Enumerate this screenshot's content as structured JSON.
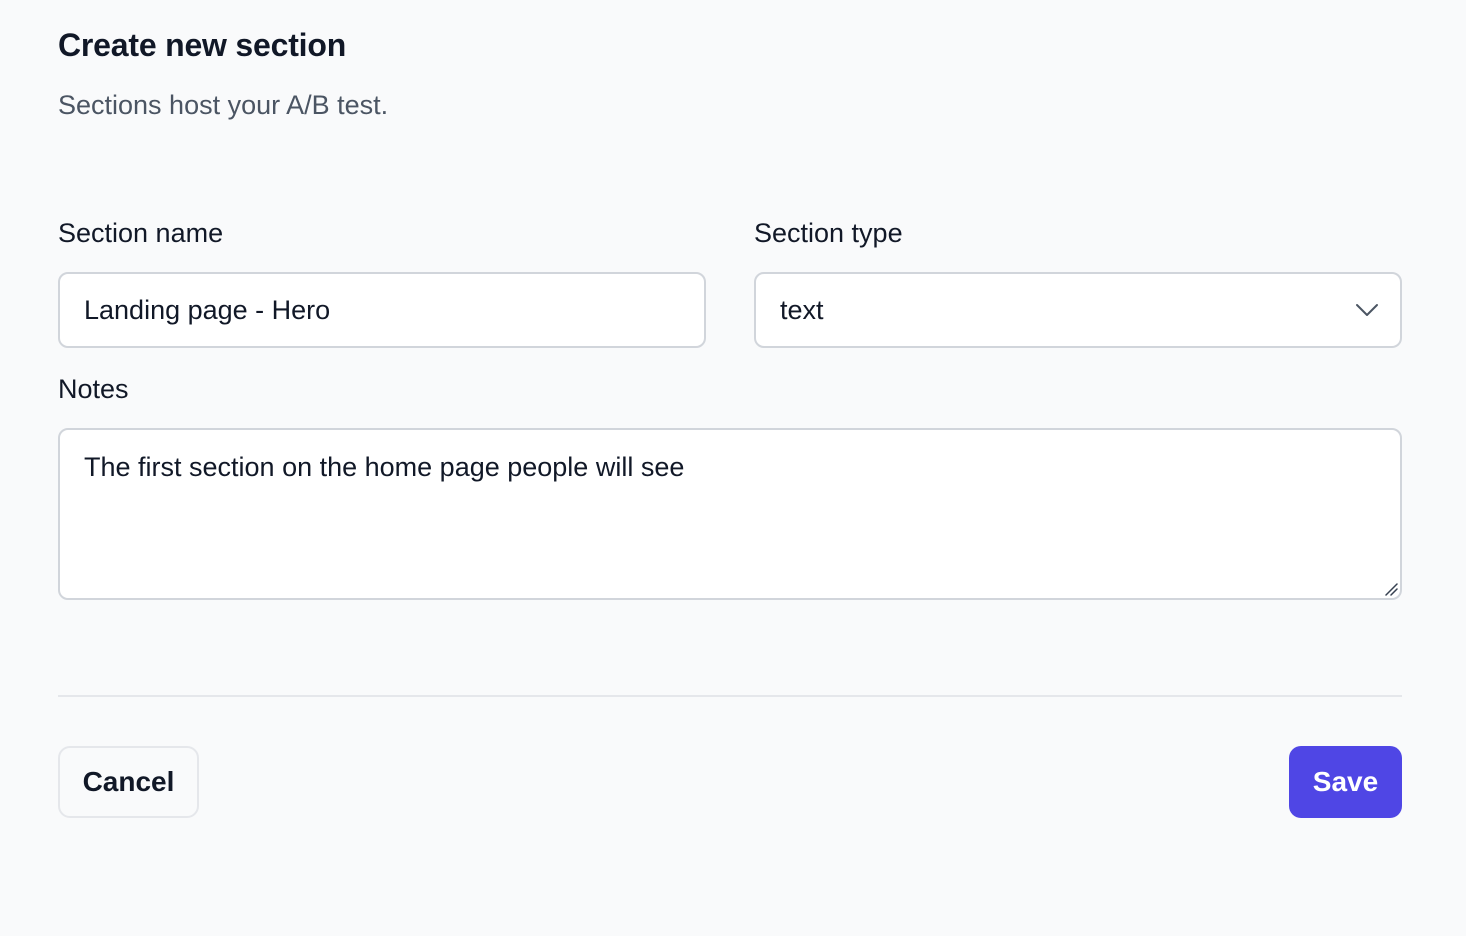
{
  "header": {
    "title": "Create new section",
    "subtitle": "Sections host your A/B test."
  },
  "form": {
    "section_name": {
      "label": "Section name",
      "value": "Landing page - Hero"
    },
    "section_type": {
      "label": "Section type",
      "selected": "text",
      "icon": "chevron-down-icon"
    },
    "notes": {
      "label": "Notes",
      "value": "The first section on the home page people will see"
    }
  },
  "actions": {
    "cancel_label": "Cancel",
    "save_label": "Save",
    "save_color": "#4f46e5"
  }
}
